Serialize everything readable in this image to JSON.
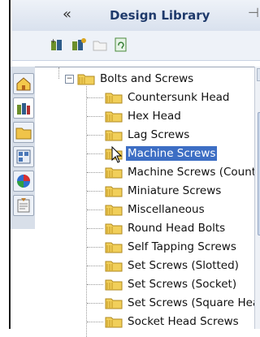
{
  "panel": {
    "title": "Design Library",
    "collapse_glyph": "«",
    "pin_glyph": "⊣"
  },
  "toolbar": {
    "buttons": [
      {
        "name": "add-to-library-icon"
      },
      {
        "name": "add-folder-icon"
      },
      {
        "name": "create-new-folder-icon"
      },
      {
        "name": "refresh-icon"
      }
    ]
  },
  "tabs": [
    {
      "name": "home-tab-icon"
    },
    {
      "name": "design-library-tab-icon"
    },
    {
      "name": "file-explorer-tab-icon"
    },
    {
      "name": "view-palette-tab-icon"
    },
    {
      "name": "appearances-tab-icon"
    },
    {
      "name": "custom-properties-tab-icon"
    }
  ],
  "tree": {
    "root": {
      "label": "Bolts and Screws",
      "expanded": true
    },
    "items": [
      {
        "label": "Countersunk Head"
      },
      {
        "label": "Hex Head"
      },
      {
        "label": "Lag Screws"
      },
      {
        "label": "Machine Screws",
        "selected": true
      },
      {
        "label": "Machine Screws (Counter"
      },
      {
        "label": "Miniature Screws"
      },
      {
        "label": "Miscellaneous"
      },
      {
        "label": "Round Head Bolts"
      },
      {
        "label": "Self Tapping Screws"
      },
      {
        "label": "Set Screws (Slotted)"
      },
      {
        "label": "Set Screws (Socket)"
      },
      {
        "label": "Set Screws (Square Head"
      },
      {
        "label": "Socket Head Screws"
      }
    ]
  },
  "colors": {
    "selection": "#3d6ec4",
    "folder": "#e8c34a",
    "title_text": "#1f3a6b"
  }
}
